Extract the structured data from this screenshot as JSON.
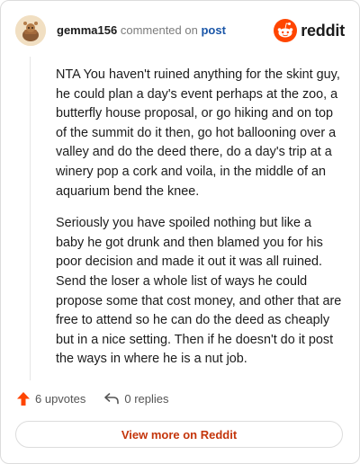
{
  "comment": {
    "author": "gemma156",
    "action_text": "commented on",
    "post_link": "post",
    "paragraphs": [
      "NTA You haven't ruined anything for the skint guy, he could plan a day's event perhaps at the zoo, a butterfly house proposal, or go hiking and on top of the summit do it then, go hot ballooning over a valley and do the deed there, do a day's trip at a winery pop a cork and voila, in the middle of an aquarium bend the knee.",
      "Seriously you have spoiled nothing but like a baby he got drunk and then blamed you for his poor decision and made it out it was all ruined. Send the loser a whole list of ways he could propose some that cost money, and other that are free to attend so he can do the deed as cheaply but in a nice setting. Then if he doesn't do it post the ways in where he is a nut job."
    ],
    "upvotes": "6 upvotes",
    "replies": "0 replies"
  },
  "brand": {
    "name": "reddit",
    "accent": "#ff4500"
  },
  "footer": {
    "view_more_label": "View more on Reddit",
    "link_color": "#c4350b"
  },
  "icons": {
    "upvote": "upvote-arrow-icon",
    "reply": "reply-arrow-icon",
    "logo": "reddit-snoo-icon"
  }
}
